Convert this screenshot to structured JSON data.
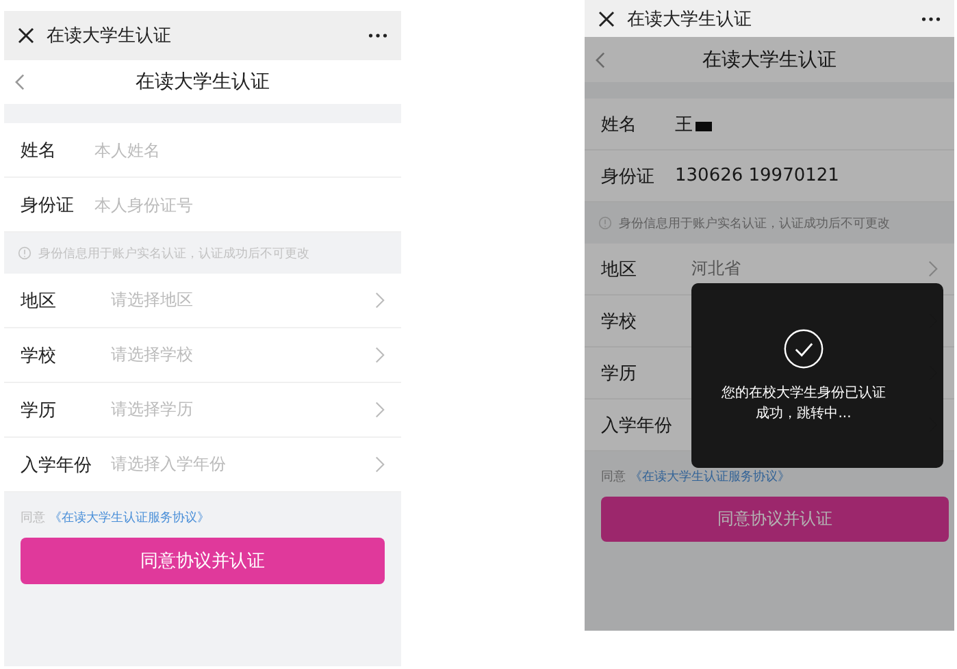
{
  "screens": [
    {
      "top_bar": {
        "title": "在读大学生认证"
      },
      "header": {
        "title": "在读大学生认证"
      },
      "identity_fields": [
        {
          "label": "姓名",
          "placeholder": "本人姓名"
        },
        {
          "label": "身份证",
          "placeholder": "本人身份证号"
        }
      ],
      "notice": "身份信息用于账户实名认证，认证成功后不可更改",
      "select_rows": [
        {
          "label": "地区",
          "placeholder": "请选择地区"
        },
        {
          "label": "学校",
          "placeholder": "请选择学校"
        },
        {
          "label": "学历",
          "placeholder": "请选择学历"
        },
        {
          "label": "入学年份",
          "placeholder": "请选择入学年份"
        }
      ],
      "agreement": {
        "prefix": "同意",
        "link": "《在读大学生认证服务协议》"
      },
      "submit_button": "同意协议并认证",
      "dimmed": false
    },
    {
      "top_bar": {
        "title": "在读大学生认证"
      },
      "header": {
        "title": "在读大学生认证"
      },
      "identity_fields": [
        {
          "label": "姓名",
          "value": "王",
          "redacted": true
        },
        {
          "label": "身份证",
          "value": "130626 19970121"
        }
      ],
      "notice": "身份信息用于账户实名认证，认证成功后不可更改",
      "select_rows": [
        {
          "label": "地区",
          "value": "河北省"
        },
        {
          "label": "学校"
        },
        {
          "label": "学历"
        },
        {
          "label": "入学年份"
        }
      ],
      "agreement": {
        "prefix": "同意",
        "link": "《在读大学生认证服务协议》"
      },
      "submit_button": "同意协议并认证",
      "dimmed": true,
      "toast": {
        "message": "您的在校大学生身份已认证成功，跳转中..."
      }
    }
  ]
}
